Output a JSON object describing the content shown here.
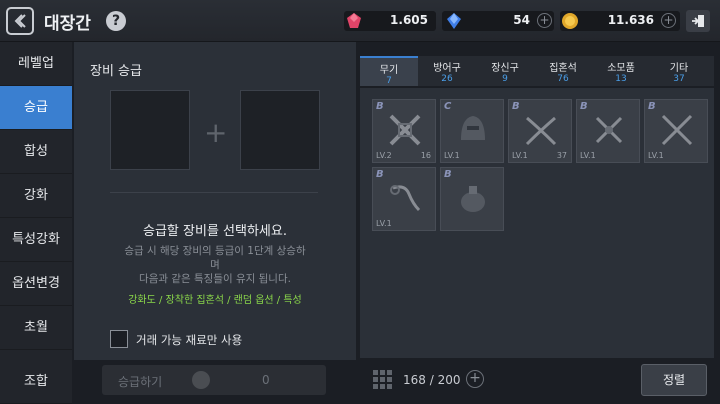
{
  "header": {
    "title": "대장간",
    "help": "?",
    "currencies": [
      {
        "icon": "ruby-icon",
        "value": "1.605"
      },
      {
        "icon": "blue-gem-icon",
        "value": "54"
      },
      {
        "icon": "gold-coin-icon",
        "value": "11.636"
      }
    ]
  },
  "sidebar": {
    "items": [
      {
        "label": "레벨업"
      },
      {
        "label": "승급"
      },
      {
        "label": "합성"
      },
      {
        "label": "강화"
      },
      {
        "label": "특성강화"
      },
      {
        "label": "옵션변경"
      },
      {
        "label": "초월"
      },
      {
        "label": "조합"
      }
    ],
    "active_index": 1
  },
  "main": {
    "section_title": "장비 승급",
    "plus": "+",
    "prompt": "승급할 장비를 선택하세요.",
    "desc_line1": "승급 시 해당 장비의 등급이 1단계 상승하",
    "desc_line2": "며",
    "desc_line3": "다음과 같은 특징들이 유지 됩니다.",
    "retained": "강화도 / 장착한 집혼석 / 랜덤 옵션 / 특성",
    "checkbox_label": "거래 가능 재료만 사용"
  },
  "tabs": [
    {
      "label": "무기",
      "count": "7"
    },
    {
      "label": "방어구",
      "count": "26"
    },
    {
      "label": "장신구",
      "count": "9"
    },
    {
      "label": "집혼석",
      "count": "76"
    },
    {
      "label": "소모품",
      "count": "13"
    },
    {
      "label": "기타",
      "count": "37"
    }
  ],
  "inventory": {
    "items": [
      {
        "grade": "B",
        "level": "LV.2",
        "count": "16",
        "icon": "crossed-swords-icon"
      },
      {
        "grade": "C",
        "level": "LV.1",
        "count": "",
        "icon": "armored-helm-icon"
      },
      {
        "grade": "B",
        "level": "LV.1",
        "count": "37",
        "icon": "crossed-scimitars-icon"
      },
      {
        "grade": "B",
        "level": "LV.1",
        "count": "",
        "icon": "crossed-daggers-icon"
      },
      {
        "grade": "B",
        "level": "LV.1",
        "count": "",
        "icon": "crossed-blades-icon"
      },
      {
        "grade": "B",
        "level": "LV.1",
        "count": "",
        "icon": "chain-whip-icon"
      },
      {
        "grade": "B",
        "level": "",
        "count": "",
        "icon": "pouch-icon"
      }
    ]
  },
  "bottom": {
    "upgrade_label": "승급하기",
    "upgrade_cost": "0",
    "inventory_count": "168 / 200",
    "sort_label": "정렬"
  },
  "colors": {
    "accent": "#3a7fd0",
    "retained_text": "#8bd84a",
    "tab_count": "#4a9ee8"
  }
}
